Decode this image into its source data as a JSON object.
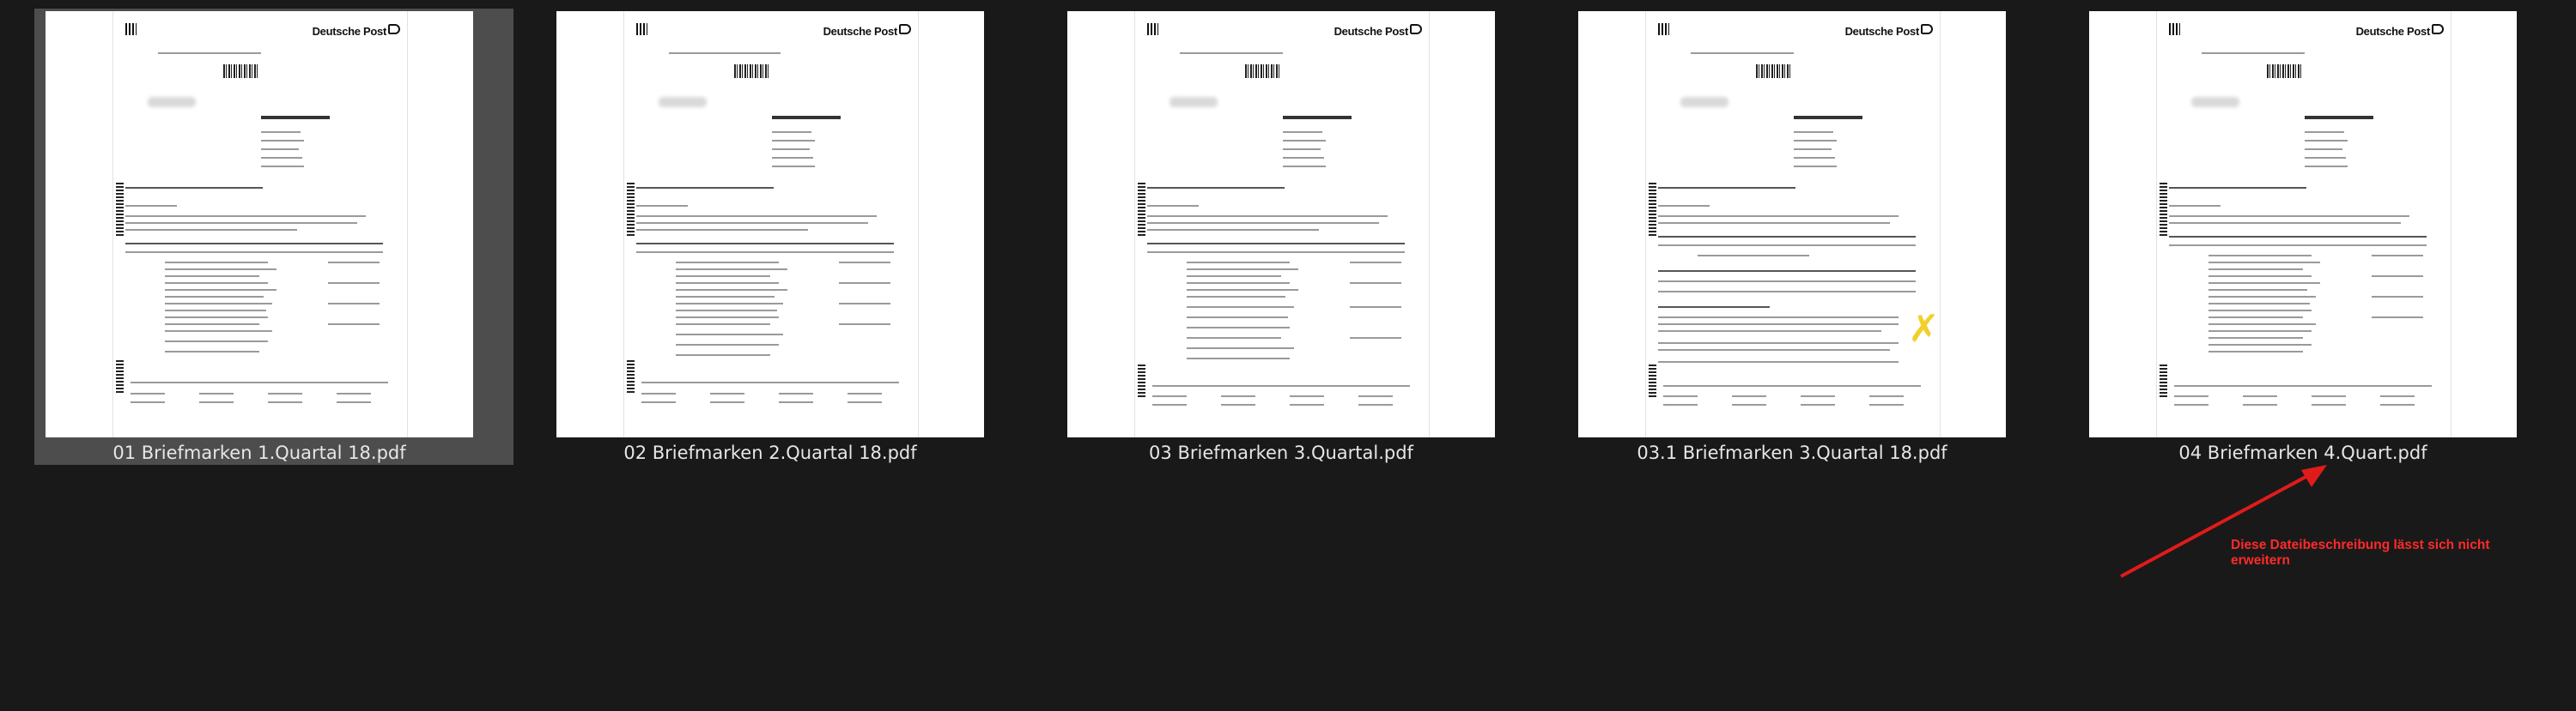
{
  "files": [
    {
      "name": "01 Briefmarken 1.Quartal 18.pdf",
      "selected": true,
      "brand": "Deutsche Post"
    },
    {
      "name": "02 Briefmarken  2.Quartal 18.pdf",
      "selected": false,
      "brand": "Deutsche Post"
    },
    {
      "name": "03 Briefmarken 3.Quartal.pdf",
      "selected": false,
      "brand": "Deutsche Post"
    },
    {
      "name": "03.1 Briefmarken 3.Quartal 18.pdf",
      "selected": false,
      "brand": "Deutsche Post"
    },
    {
      "name": "04 Briefmarken 4.Quart.pdf",
      "selected": false,
      "brand": "Deutsche Post"
    }
  ],
  "annotation": {
    "text": "Diese Dateibeschreibung lässt sich nicht erweitern",
    "color": "#ff2a2a"
  },
  "colors": {
    "background": "#191919",
    "selection": "#4d4d4d",
    "caption": "#e6e6e6"
  }
}
